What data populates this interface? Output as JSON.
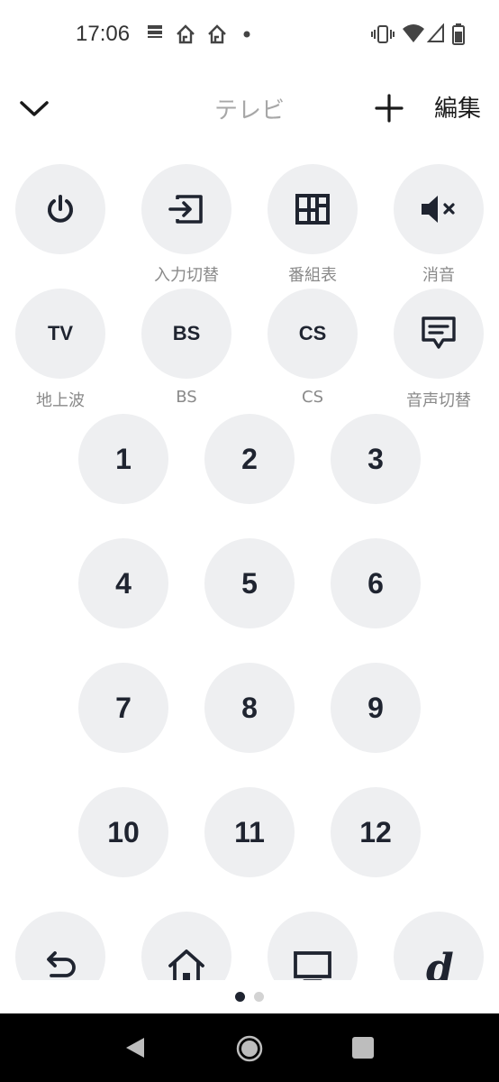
{
  "status_bar": {
    "time": "17:06",
    "icons": [
      "notification-icon",
      "home-icon",
      "home-icon",
      "dot-icon",
      "vibrate-icon",
      "wifi-icon",
      "signal-icon",
      "battery-icon"
    ]
  },
  "header": {
    "title": "テレビ",
    "edit_label": "編集"
  },
  "row1": {
    "input_label": "入力切替",
    "guide_label": "番組表",
    "mute_label": "消音"
  },
  "row2": {
    "tv_text": "TV",
    "tv_label": "地上波",
    "bs_text": "BS",
    "bs_label": "BS",
    "cs_text": "CS",
    "cs_label": "CS",
    "audio_label": "音声切替"
  },
  "numbers": [
    "1",
    "2",
    "3",
    "4",
    "5",
    "6",
    "7",
    "8",
    "9",
    "10",
    "11",
    "12"
  ],
  "colors": {
    "button_bg": "#eeeff1",
    "icon": "#1f2430",
    "caption": "#8a8a8a",
    "title": "#a7a7a7",
    "page_dot_active": "#1f2430",
    "page_dot_inactive": "#d3d3d3"
  }
}
